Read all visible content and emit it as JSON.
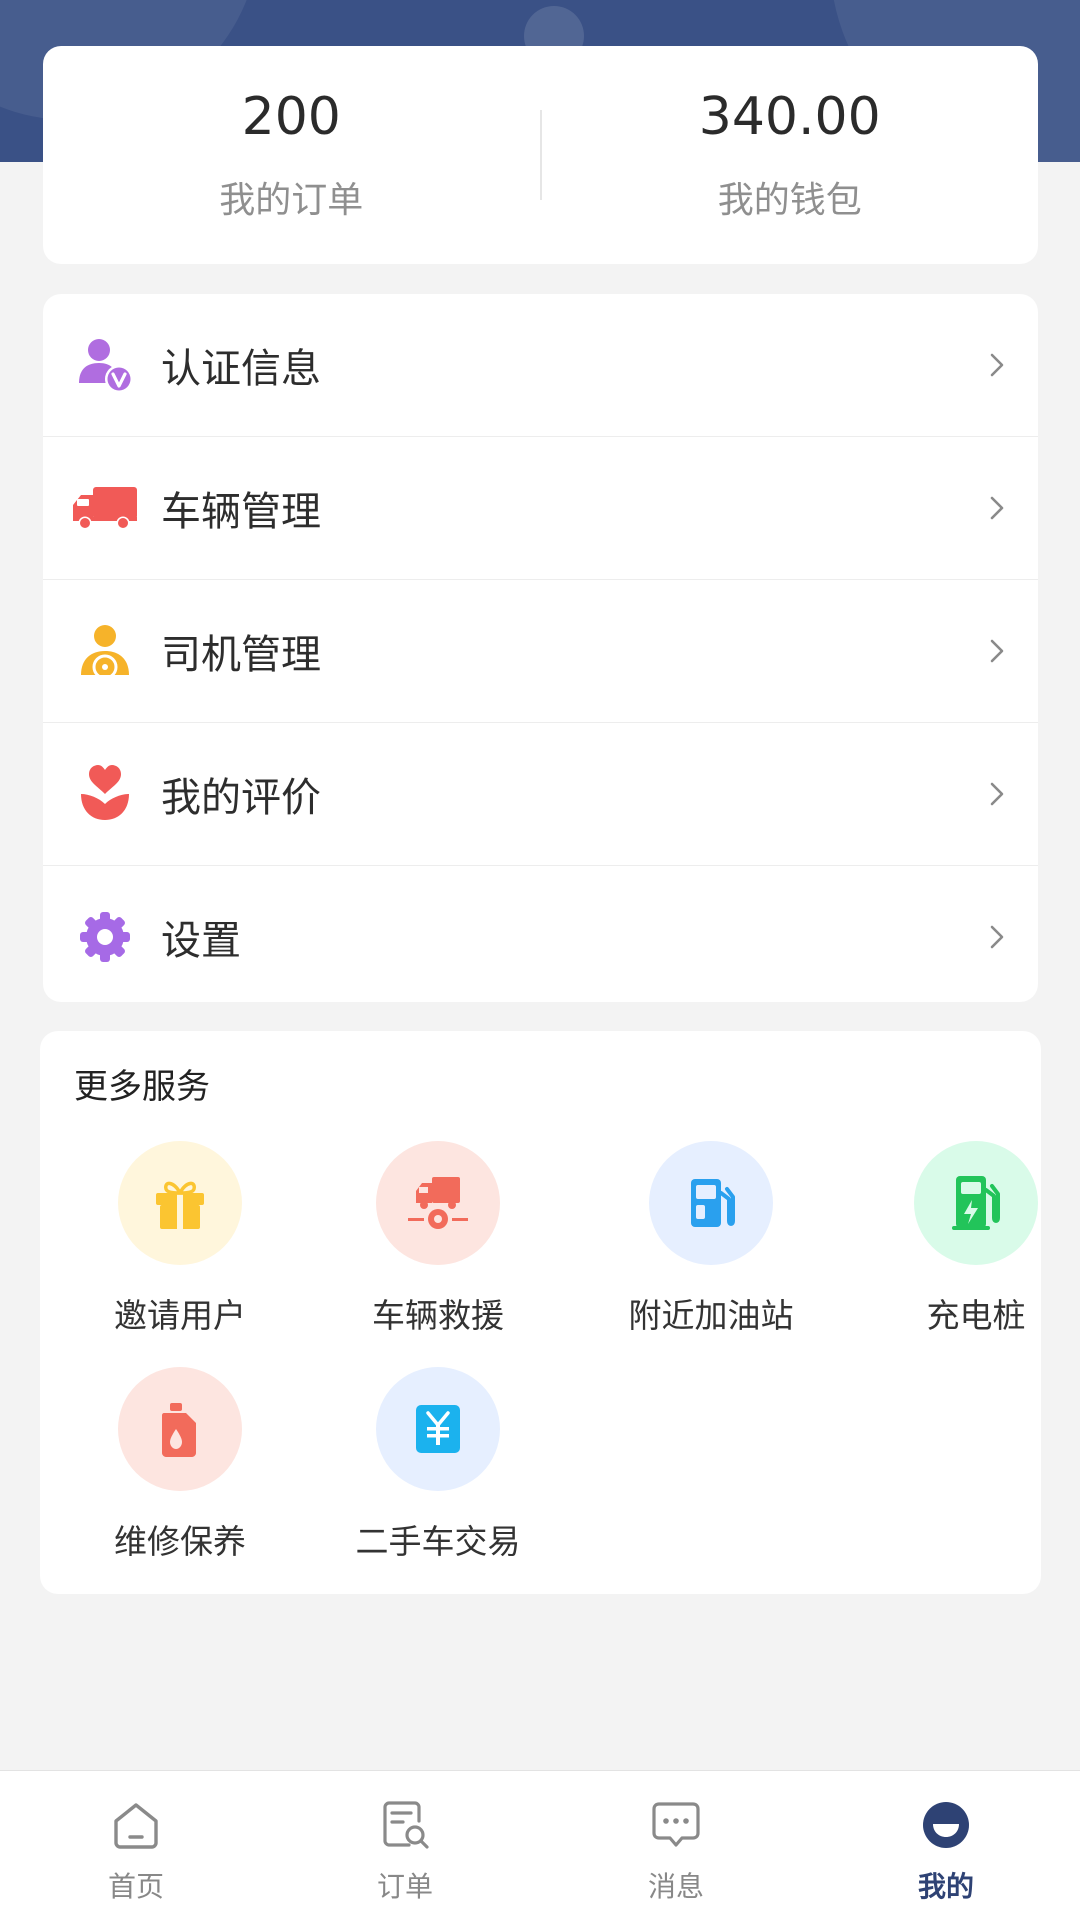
{
  "stats": {
    "orders": {
      "value": "200",
      "label": "我的订单"
    },
    "wallet": {
      "value": "340.00",
      "label": "我的钱包"
    }
  },
  "menu": {
    "items": [
      {
        "label": "认证信息",
        "icon": "certified-user-icon",
        "color": "#b06de0"
      },
      {
        "label": "车辆管理",
        "icon": "truck-icon",
        "color": "#f15a57"
      },
      {
        "label": "司机管理",
        "icon": "driver-icon",
        "color": "#f6b32a"
      },
      {
        "label": "我的评价",
        "icon": "heart-flower-icon",
        "color": "#f15a57"
      },
      {
        "label": "设置",
        "icon": "gear-icon",
        "color": "#a66ae6"
      }
    ]
  },
  "services": {
    "title": "更多服务",
    "items": [
      {
        "label": "邀请用户",
        "icon": "gift-icon",
        "bg": "#fff6dc",
        "color": "#fbc531"
      },
      {
        "label": "车辆救援",
        "icon": "rescue-truck-icon",
        "bg": "#fde5e0",
        "color": "#f26b5b"
      },
      {
        "label": "附近加油站",
        "icon": "fuel-pump-icon",
        "bg": "#e6efff",
        "color": "#2aa0ee"
      },
      {
        "label": "充电桩",
        "icon": "charging-pile-icon",
        "bg": "#d9fbe9",
        "color": "#22c45a"
      },
      {
        "label": "维修保养",
        "icon": "oil-can-icon",
        "bg": "#fde5e0",
        "color": "#f26b5b"
      },
      {
        "label": "二手车交易",
        "icon": "yen-receipt-icon",
        "bg": "#e6efff",
        "color": "#1bb2ee"
      }
    ]
  },
  "tabbar": {
    "items": [
      {
        "label": "首页",
        "icon": "home-icon"
      },
      {
        "label": "订单",
        "icon": "order-search-icon"
      },
      {
        "label": "消息",
        "icon": "message-icon"
      },
      {
        "label": "我的",
        "icon": "profile-icon",
        "active": true
      }
    ],
    "active_color": "#2e4274",
    "inactive_color": "#888888"
  }
}
